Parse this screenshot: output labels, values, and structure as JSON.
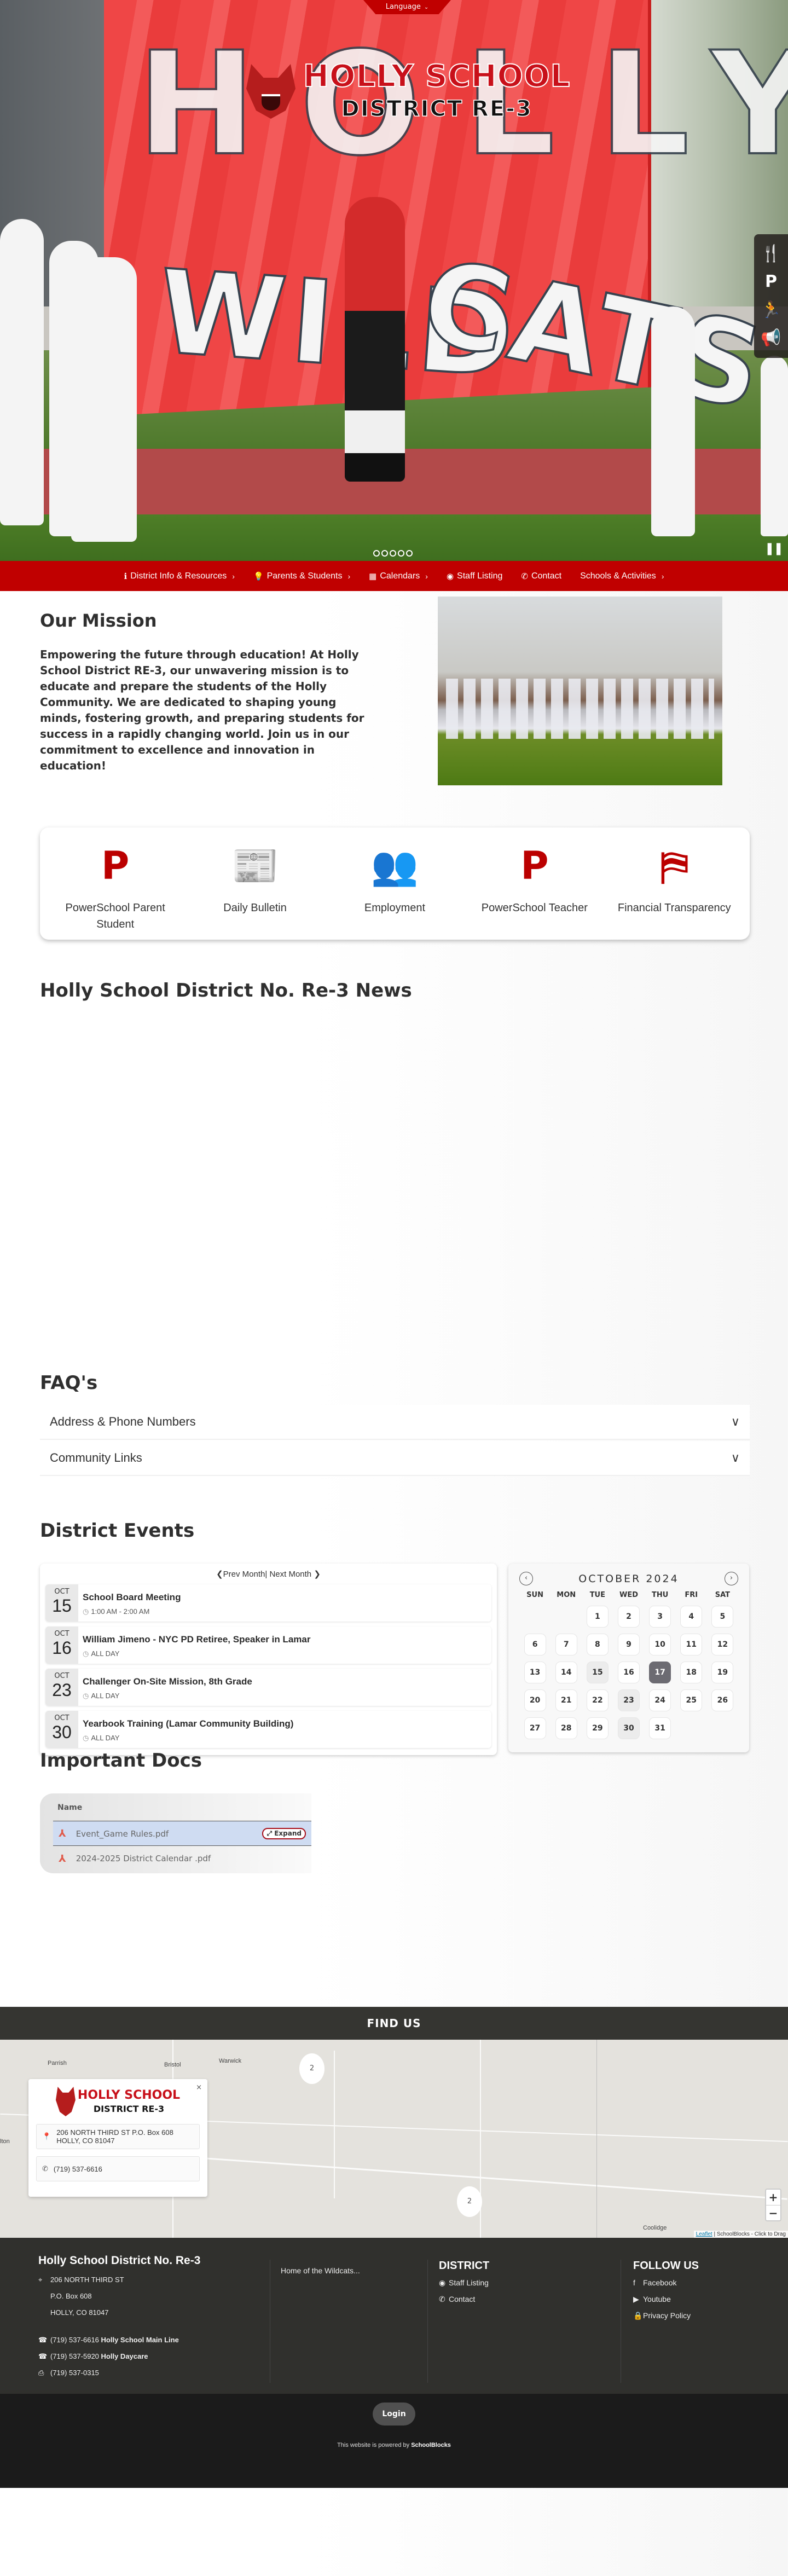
{
  "header": {
    "language_label": "Language",
    "logo_line1": "HOLLY SCHOOL",
    "logo_line2": "DISTRICT RE-3",
    "banner_words": [
      "HOLLY",
      "WILD",
      "CATS"
    ],
    "quick_rail": [
      {
        "icon": "fork-knife-icon",
        "glyph": "🍴"
      },
      {
        "icon": "powerschool-icon",
        "glyph": "P"
      },
      {
        "icon": "running-person-icon",
        "glyph": "🏃"
      },
      {
        "icon": "megaphone-icon",
        "glyph": "📢"
      }
    ],
    "slide_count": 5,
    "pause_glyph": "❚❚"
  },
  "nav": {
    "items": [
      {
        "label": "District Info & Resources",
        "icon": "info-icon",
        "glyph": "ℹ",
        "has_submenu": true
      },
      {
        "label": "Parents & Students",
        "icon": "lightbulb-icon",
        "glyph": "💡",
        "has_submenu": true
      },
      {
        "label": "Calendars",
        "icon": "calendar-icon",
        "glyph": "▦",
        "has_submenu": true
      },
      {
        "label": "Staff Listing",
        "icon": "staff-icon",
        "glyph": "◉",
        "has_submenu": false
      },
      {
        "label": "Contact",
        "icon": "phone-icon",
        "glyph": "✆",
        "has_submenu": false
      },
      {
        "label": "Schools & Activities",
        "icon": "",
        "glyph": "",
        "has_submenu": true
      }
    ],
    "submenu_glyph": "›"
  },
  "mission": {
    "title": "Our Mission",
    "body": "Empowering the future through education! At Holly School District RE-3, our unwavering mission is to educate and prepare the students of the Holly Community. We are dedicated to shaping young minds, fostering growth, and preparing students for success in a rapidly changing world. Join us in our commitment to excellence and innovation in education!"
  },
  "quick_links": [
    {
      "label": "PowerSchool Parent Student",
      "icon": "powerschool-icon",
      "glyph": "P"
    },
    {
      "label": "Daily Bulletin",
      "icon": "bulletin-icon",
      "glyph": "📰"
    },
    {
      "label": "Employment",
      "icon": "people-icon",
      "glyph": "👥"
    },
    {
      "label": "PowerSchool Teacher",
      "icon": "powerschool-icon",
      "glyph": "P"
    },
    {
      "label": "Financial Transparency",
      "icon": "colorado-flag-icon",
      "glyph": "⛿"
    }
  ],
  "news": {
    "title": "Holly School District No. Re-3 News"
  },
  "faq": {
    "title": "FAQ's",
    "items": [
      {
        "label": "Address & Phone Numbers"
      },
      {
        "label": "Community Links"
      }
    ],
    "chevron": "∨"
  },
  "events": {
    "title": "District Events",
    "prev_label": "❮Prev Month",
    "next_label": " Next Month ❯",
    "separator": "|",
    "list": [
      {
        "month": "OCT",
        "day": "15",
        "title": "School Board Meeting",
        "time": "1:00 AM - 2:00 AM"
      },
      {
        "month": "OCT",
        "day": "16",
        "title": "William Jimeno - NYC PD Retiree, Speaker in Lamar",
        "time": "ALL DAY"
      },
      {
        "month": "OCT",
        "day": "23",
        "title": "Challenger On-Site Mission, 8th Grade",
        "time": "ALL DAY"
      },
      {
        "month": "OCT",
        "day": "30",
        "title": "Yearbook Training (Lamar Community Building)",
        "time": "ALL DAY"
      }
    ]
  },
  "calendar": {
    "month_label": "OCTOBER 2024",
    "prev_glyph": "‹",
    "next_glyph": "›",
    "weekdays": [
      "SUN",
      "MON",
      "TUE",
      "WED",
      "THU",
      "FRI",
      "SAT"
    ],
    "first_weekday_index": 2,
    "days_in_month": 31,
    "today": 17,
    "event_days": [
      15,
      23,
      30
    ]
  },
  "docs": {
    "title": "Important Docs",
    "column_header": "Name",
    "files": [
      {
        "name": "Event_Game Rules.pdf",
        "selected": true
      },
      {
        "name": "2024-2025 District Calendar .pdf",
        "selected": false
      }
    ],
    "expand_label": "Expand"
  },
  "find_us": {
    "title": "FIND US",
    "towns": [
      "Parrish",
      "Bristol",
      "Warwick",
      "Coolidge",
      "lton"
    ],
    "clusters": [
      "2",
      "2"
    ],
    "popup": {
      "logo_line1": "HOLLY SCHOOL",
      "logo_line2": "DISTRICT RE-3",
      "address": "206 NORTH THIRD ST P.O. Box 608 HOLLY, CO 81047",
      "phone": "(719) 537-6616",
      "close": "×"
    },
    "zoom_in": "+",
    "zoom_out": "−",
    "attribution_link": "Leaflet",
    "attribution_text": " | SchoolBlocks - Click to Drag"
  },
  "footer": {
    "org_name": "Holly School District No. Re-3",
    "address_lines": [
      "206 NORTH THIRD ST",
      "P.O. Box 608",
      "HOLLY, CO 81047"
    ],
    "phones": [
      {
        "number": "(719) 537-6616",
        "label": "Holly School Main Line",
        "icon": "phone-icon"
      },
      {
        "number": "(719) 537-5920",
        "label": "Holly Daycare",
        "icon": "phone-icon"
      },
      {
        "number": "(719) 537-0315",
        "label": "",
        "icon": "fax-icon"
      }
    ],
    "tagline": "Home of the Wildcats...",
    "district": {
      "title": "DISTRICT",
      "links": [
        {
          "label": "Staff Listing",
          "icon": "staff-icon",
          "glyph": "◉"
        },
        {
          "label": "Contact",
          "icon": "phone-icon",
          "glyph": "✆"
        }
      ]
    },
    "follow": {
      "title": "FOLLOW US",
      "links": [
        {
          "label": "Facebook",
          "icon": "facebook-icon",
          "glyph": "f"
        },
        {
          "label": "Youtube",
          "icon": "youtube-icon",
          "glyph": "▶"
        },
        {
          "label": "Privacy Policy",
          "icon": "lock-icon",
          "glyph": "🔒"
        }
      ]
    },
    "login_label": "Login",
    "powered_prefix": "This website is powered by ",
    "powered_brand": "SchoolBlocks"
  },
  "colors": {
    "brand_red": "#c00000",
    "footer_dark": "#30302d",
    "bottom_dark": "#1b1b1b",
    "today_highlight": "#6c6b72"
  }
}
